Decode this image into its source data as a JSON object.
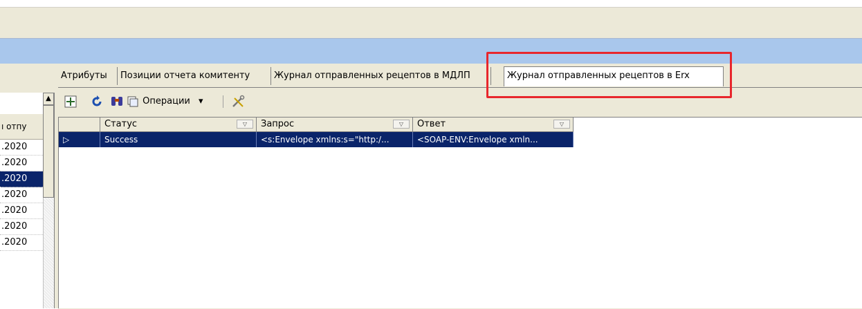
{
  "left_panel": {
    "header": "ı отпу",
    "rows": [
      ".2020",
      ".2020",
      ".2020",
      ".2020",
      ".2020",
      ".2020",
      ".2020"
    ],
    "selected_index": 2
  },
  "tabs": [
    {
      "label": "Атрибуты",
      "active": false
    },
    {
      "label": "Позиции отчета комитенту",
      "active": false
    },
    {
      "label": "Журнал отправленных рецептов в МДЛП",
      "active": false
    },
    {
      "label": "Журнал отправленных рецептов в Erx",
      "active": true
    }
  ],
  "toolbar": {
    "operations_label": "Операции",
    "dropdown_arrow": "▾"
  },
  "grid": {
    "columns": [
      "Статус",
      "Запрос",
      "Ответ"
    ],
    "rows": [
      {
        "marker": "▷",
        "status": "Success",
        "request": "<s:Envelope xmlns:s=\"http:/...",
        "response": "<SOAP-ENV:Envelope xmln..."
      }
    ]
  },
  "colors": {
    "highlight": "#e8262c",
    "selection": "#0a246a",
    "title_band": "#a9c7ec",
    "panel": "#ece9d8"
  }
}
